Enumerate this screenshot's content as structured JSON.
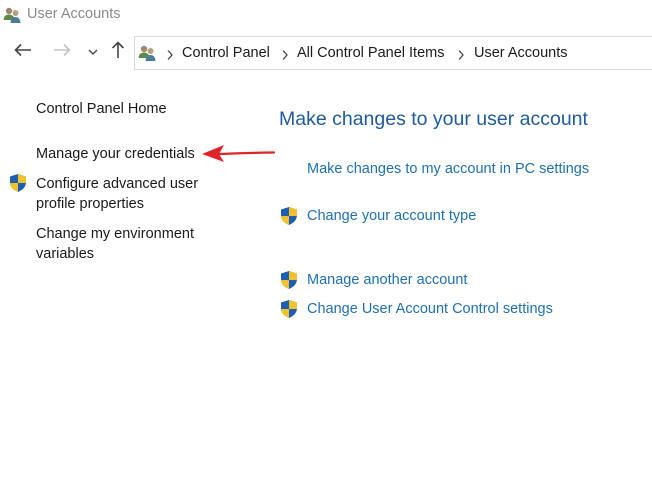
{
  "window": {
    "title": "User Accounts"
  },
  "breadcrumb": {
    "items": [
      "Control Panel",
      "All Control Panel Items",
      "User Accounts"
    ]
  },
  "sidebar": {
    "items": [
      {
        "label": "Control Panel Home"
      },
      {
        "label": "Manage your credentials"
      },
      {
        "label_line1": "Configure advanced user",
        "label_line2": "profile properties"
      },
      {
        "label_line1": "Change my environment",
        "label_line2": "variables"
      }
    ]
  },
  "main": {
    "title": "Make changes to your user account",
    "tasks": [
      {
        "label": "Make changes to my account in PC settings"
      },
      {
        "label": "Change your account type"
      },
      {
        "label": "Manage another account"
      },
      {
        "label": "Change User Account Control settings"
      }
    ]
  },
  "colors": {
    "link": "#1e6fb5",
    "heading": "#1e5aa0",
    "annotation_arrow": "#e0252a"
  }
}
